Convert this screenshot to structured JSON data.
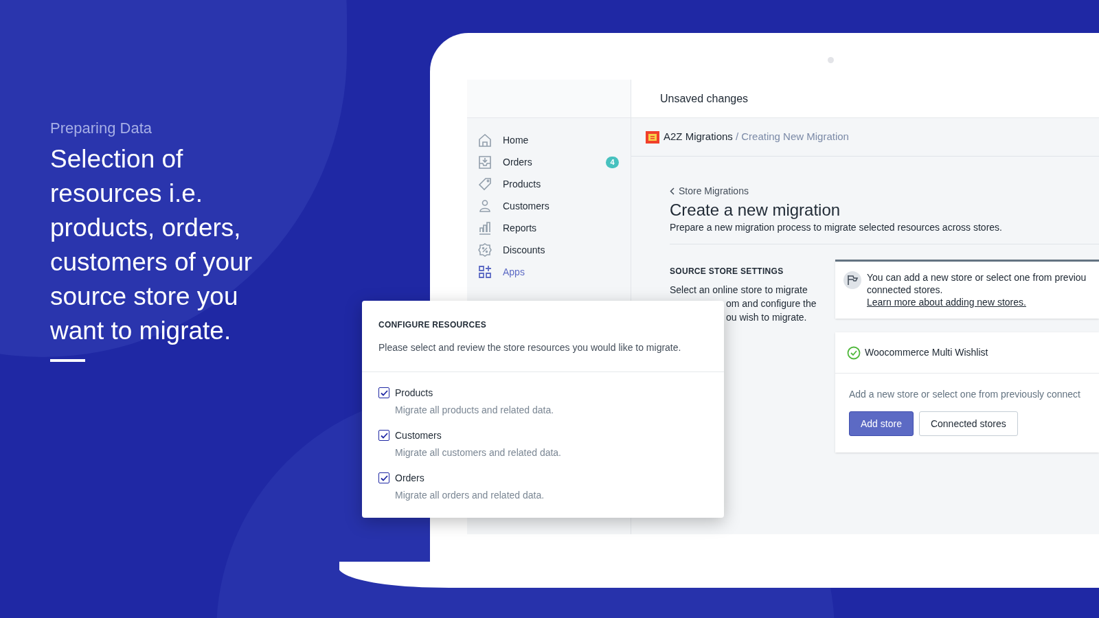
{
  "hero": {
    "eyebrow": "Preparing Data",
    "headline": "Selection of resources i.e. products, orders, customers of your source store you want to migrate."
  },
  "app": {
    "header": {
      "title": "Unsaved changes"
    },
    "sidebar": {
      "items": [
        {
          "kind": "home",
          "label": "Home",
          "selected": false
        },
        {
          "kind": "orders",
          "label": "Orders",
          "selected": false,
          "badge": "4"
        },
        {
          "kind": "products",
          "label": "Products",
          "selected": false
        },
        {
          "kind": "customers",
          "label": "Customers",
          "selected": false
        },
        {
          "kind": "reports",
          "label": "Reports",
          "selected": false
        },
        {
          "kind": "discounts",
          "label": "Discounts",
          "selected": false
        },
        {
          "kind": "apps",
          "label": "Apps",
          "selected": true
        }
      ]
    },
    "breadcrumb": {
      "app": "A2Z Migrations",
      "current": "/ Creating New Migration"
    },
    "page": {
      "back_link": "Store Migrations",
      "title": "Create a new migration",
      "description": "Prepare a new migration process to migrate selected resources across stores.",
      "source_settings": {
        "heading": "SOURCE STORE SETTINGS",
        "text_lines": [
          "Select an online store to migrate",
          "om and configure the",
          "ou wish to migrate."
        ]
      },
      "info_banner": {
        "text": "You can add a new store or select one from previou",
        "text_2": "connected stores.",
        "link": "Learn more about adding new stores."
      },
      "store_card": {
        "store_name": "Woocommerce Multi Wishlist",
        "hint": "Add a new store or select one from previously connect",
        "buttons": [
          {
            "kind": "primary",
            "label": "Add store"
          },
          {
            "kind": "secondary",
            "label": "Connected stores"
          }
        ]
      }
    }
  },
  "dialog": {
    "title": "CONFIGURE RESOURCES",
    "description": "Please select and review the store resources you would like to migrate.",
    "options": [
      {
        "label": "Products",
        "description": "Migrate all products and related data.",
        "checked": true
      },
      {
        "label": "Customers",
        "description": "Migrate all customers and related data.",
        "checked": true
      },
      {
        "label": "Orders",
        "description": "Migrate all orders and related data.",
        "checked": true
      }
    ]
  }
}
